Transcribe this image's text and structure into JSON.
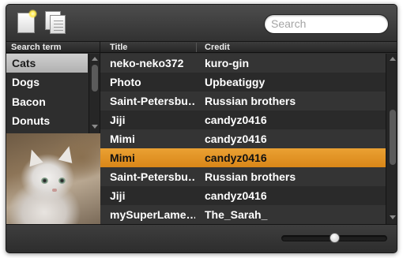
{
  "toolbar": {
    "new_icon": "new-document-icon",
    "duplicate_icon": "duplicate-documents-icon",
    "search": {
      "placeholder": "Search",
      "value": ""
    }
  },
  "search_terms": {
    "header": "Search term",
    "items": [
      "Cats",
      "Dogs",
      "Bacon",
      "Donuts"
    ],
    "selected": "Cats"
  },
  "preview": {
    "icon": "white-cat-photo"
  },
  "results": {
    "columns": {
      "title": "Title",
      "credit": "Credit"
    },
    "rows": [
      {
        "title": "neko-neko372",
        "credit": "kuro-gin"
      },
      {
        "title": "Photo",
        "credit": "Upbeatiggy"
      },
      {
        "title": "Saint-Petersbu…",
        "credit": "Russian brothers"
      },
      {
        "title": "Jiji",
        "credit": "candyz0416"
      },
      {
        "title": "Mimi",
        "credit": "candyz0416"
      },
      {
        "title": "Mimi",
        "credit": "candyz0416"
      },
      {
        "title": "Saint-Petersbu…",
        "credit": "Russian brothers"
      },
      {
        "title": "Jiji",
        "credit": "candyz0416"
      },
      {
        "title": "mySuperLame…",
        "credit": "The_Sarah_"
      }
    ],
    "selected_index": 5
  },
  "bottom": {
    "slider_value": 0.5
  },
  "colors": {
    "accent": "#e49528",
    "window_bg": "#2b2b2b"
  }
}
